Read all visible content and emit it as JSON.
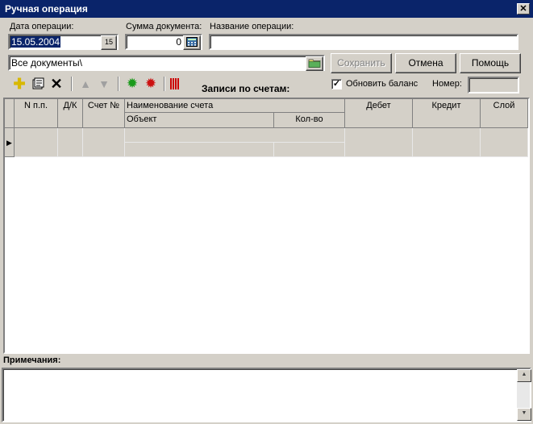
{
  "window": {
    "title": "Ручная операция"
  },
  "fields": {
    "date_label": "Дата операции:",
    "date_value": "15.05.2004",
    "sum_label": "Сумма документа:",
    "sum_value": "0",
    "name_label": "Название операции:",
    "name_value": "",
    "path_value": "Все документы\\"
  },
  "buttons": {
    "save": "Сохранить",
    "cancel": "Отмена",
    "help": "Помощь"
  },
  "toolbar": {
    "records_label": "Записи по счетам:",
    "refresh_balance_label": "Обновить баланс",
    "refresh_balance_checked": true,
    "number_label": "Номер:",
    "number_value": ""
  },
  "grid": {
    "columns": {
      "npp": "N п.п.",
      "dk": "Д/К",
      "account": "Счет №",
      "account_name": "Наименование счета",
      "object": "Объект",
      "qty": "Кол-во",
      "debit": "Дебет",
      "credit": "Кредит",
      "layer": "Слой"
    }
  },
  "notes": {
    "label": "Примечания:",
    "value": ""
  },
  "icons": {
    "close": "close-icon",
    "calendar": "calendar-icon",
    "calculator": "calculator-icon",
    "folder": "folder-icon",
    "add": "add-icon",
    "properties": "properties-icon",
    "delete": "delete-icon",
    "move_up": "arrow-up-icon",
    "move_down": "arrow-down-icon",
    "gear_green": "gear-green-icon",
    "gear_red": "gear-red-icon",
    "barcode": "barcode-icon",
    "row_pointer": "row-pointer-icon"
  },
  "colors": {
    "titlebar": "#0a246a",
    "face": "#d4d0c8",
    "selection": "#0a246a"
  }
}
